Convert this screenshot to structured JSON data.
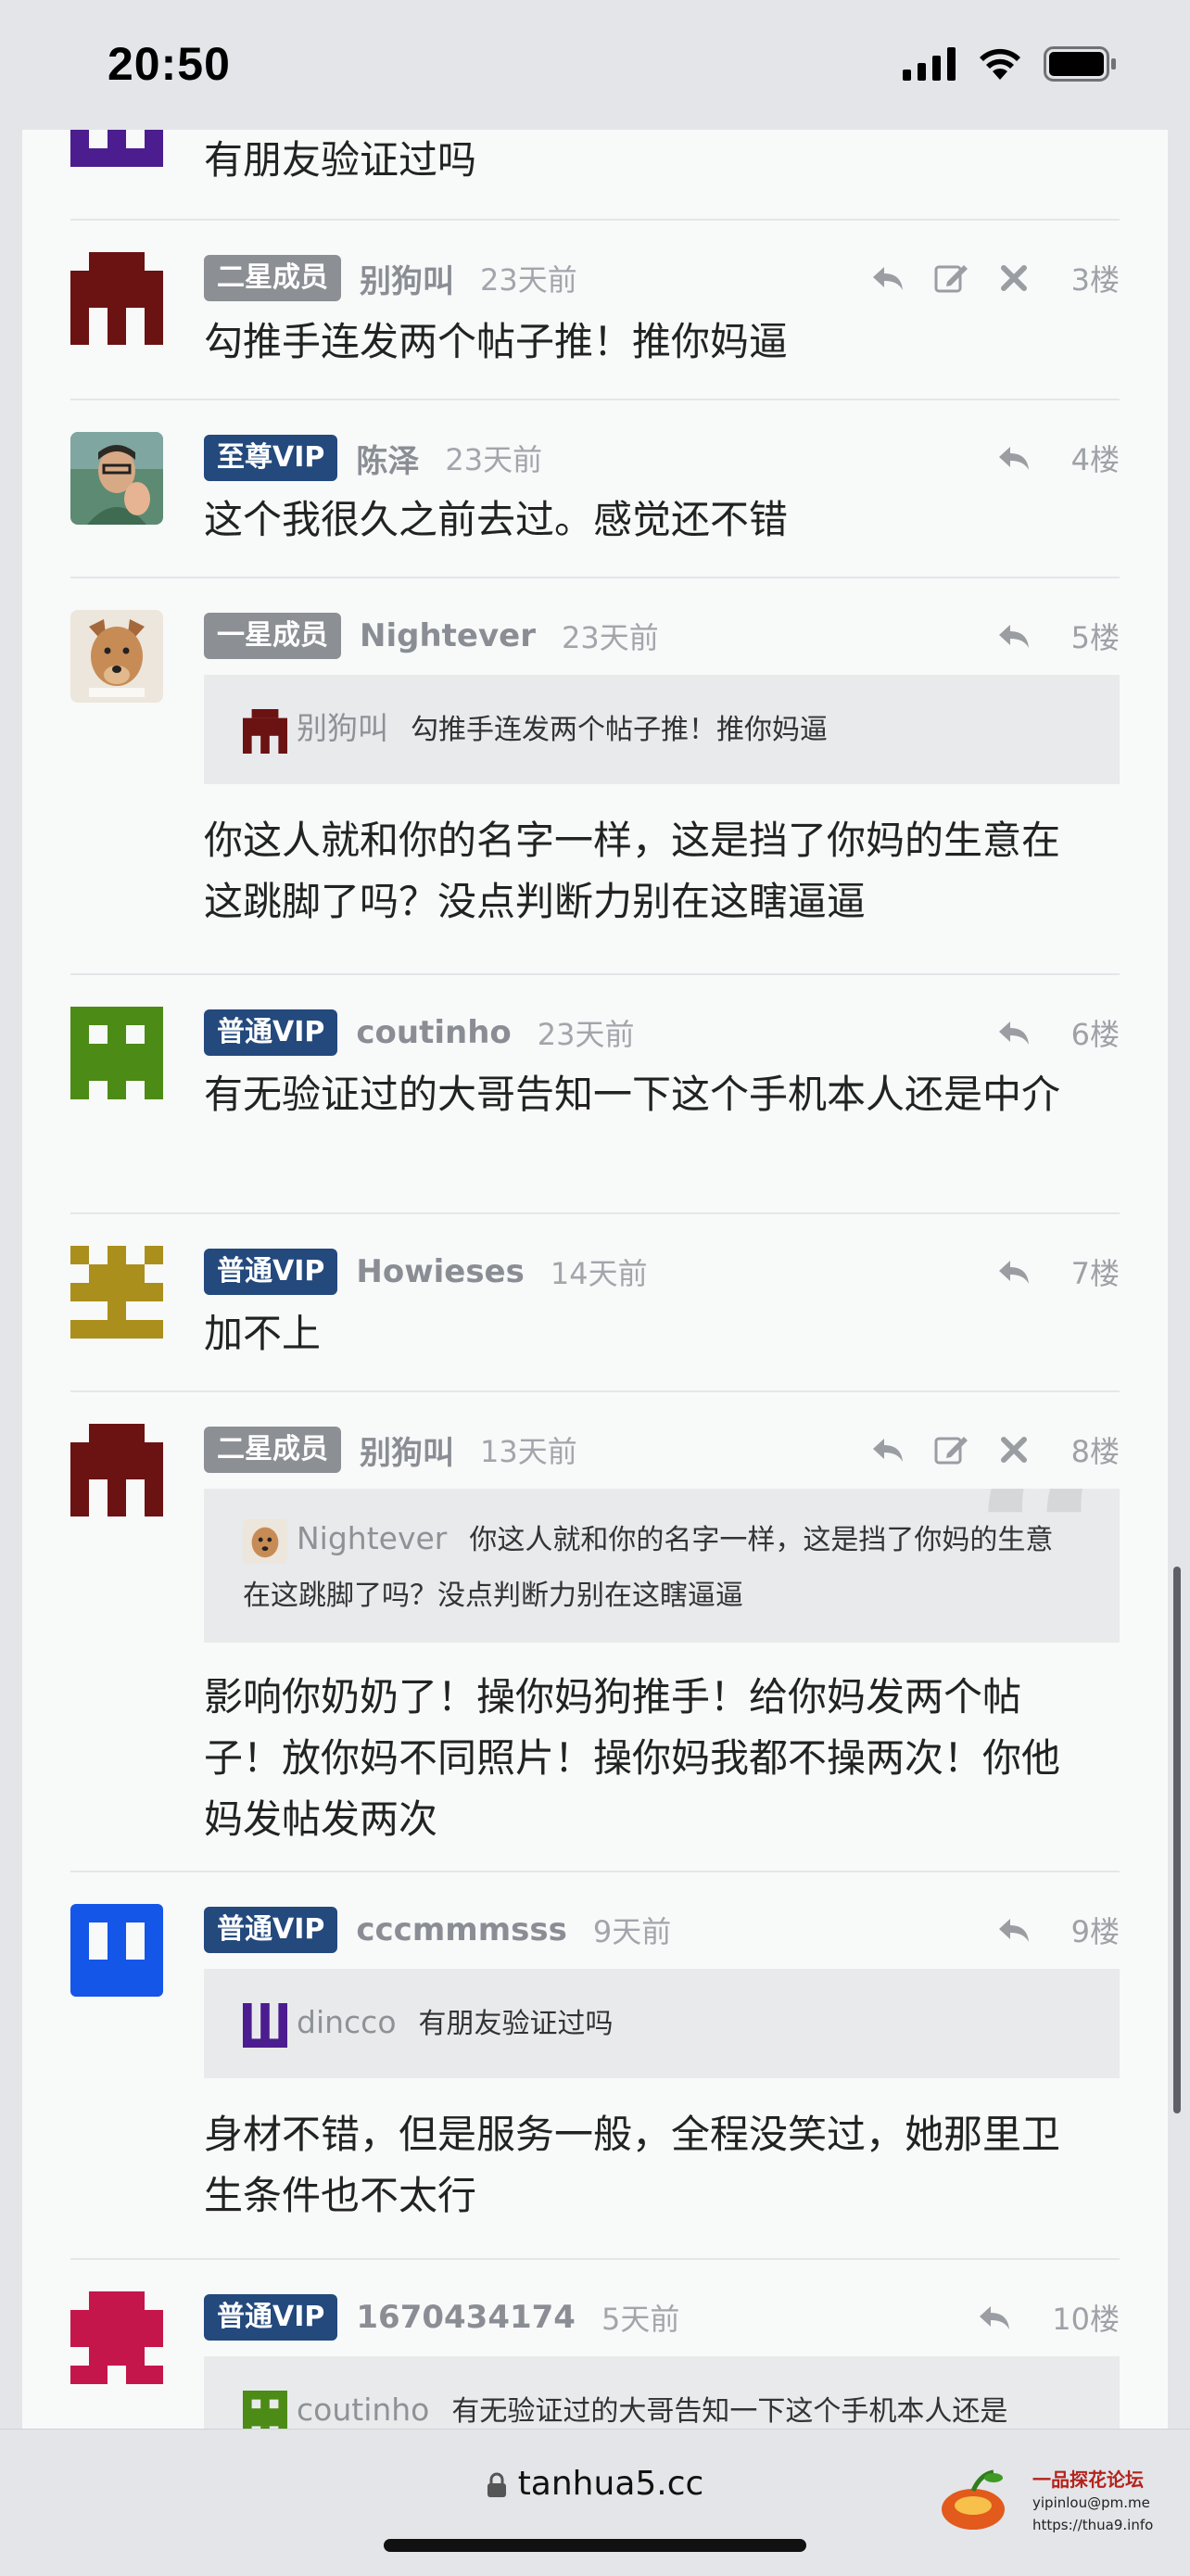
{
  "status_bar": {
    "time": "20:50"
  },
  "thread_fragment": {
    "text": "有朋友验证过吗"
  },
  "posts": [
    {
      "badge": "二星成员",
      "user": "别狗叫",
      "time": "23天前",
      "floor": "3楼",
      "text": "勾推手连发两个帖子推！推你妈逼"
    },
    {
      "badge": "至尊VIP",
      "user": "陈泽",
      "time": "23天前",
      "floor": "4楼",
      "text": "这个我很久之前去过。感觉还不错"
    },
    {
      "badge": "一星成员",
      "user": "Nightever",
      "time": "23天前",
      "floor": "5楼",
      "quote": {
        "user": "别狗叫",
        "text": "勾推手连发两个帖子推！推你妈逼"
      },
      "text": "你这人就和你的名字一样，这是挡了你妈的生意在这跳脚了吗？没点判断力别在这瞎逼逼"
    },
    {
      "badge": "普通VIP",
      "user": "coutinho",
      "time": "23天前",
      "floor": "6楼",
      "text": "有无验证过的大哥告知一下这个手机本人还是中介"
    },
    {
      "badge": "普通VIP",
      "user": "Howieses",
      "time": "14天前",
      "floor": "7楼",
      "text": "加不上"
    },
    {
      "badge": "二星成员",
      "user": "别狗叫",
      "time": "13天前",
      "floor": "8楼",
      "quote": {
        "user": "Nightever",
        "text": "你这人就和你的名字一样，这是挡了你妈的生意在这跳脚了吗？没点判断力别在这瞎逼逼"
      },
      "text": "影响你奶奶了！操你妈狗推手！给你妈发两个帖子！放你妈不同照片！操你妈我都不操两次！你他妈发帖发两次"
    },
    {
      "badge": "普通VIP",
      "user": "cccmmmsss",
      "time": "9天前",
      "floor": "9楼",
      "quote": {
        "user": "dincco",
        "text": "有朋友验证过吗"
      },
      "text": "身材不错，但是服务一般，全程没笑过，她那里卫生条件也不太行"
    },
    {
      "badge": "普通VIP",
      "user": "1670434174",
      "time": "5天前",
      "floor": "10楼",
      "quote": {
        "user": "coutinho",
        "text": "有无验证过的大哥告知一下这个手机本人还是"
      }
    }
  ],
  "browser": {
    "url": "tanhua5.cc"
  },
  "watermark": {
    "title": "一品探花论坛",
    "line1": "yipinlou@pm.me",
    "line2": "https://thua9.info"
  },
  "colors": {
    "badge_gray": "#8c8f94",
    "badge_navy": "#23497d",
    "page_bg": "#f8f9f9"
  }
}
